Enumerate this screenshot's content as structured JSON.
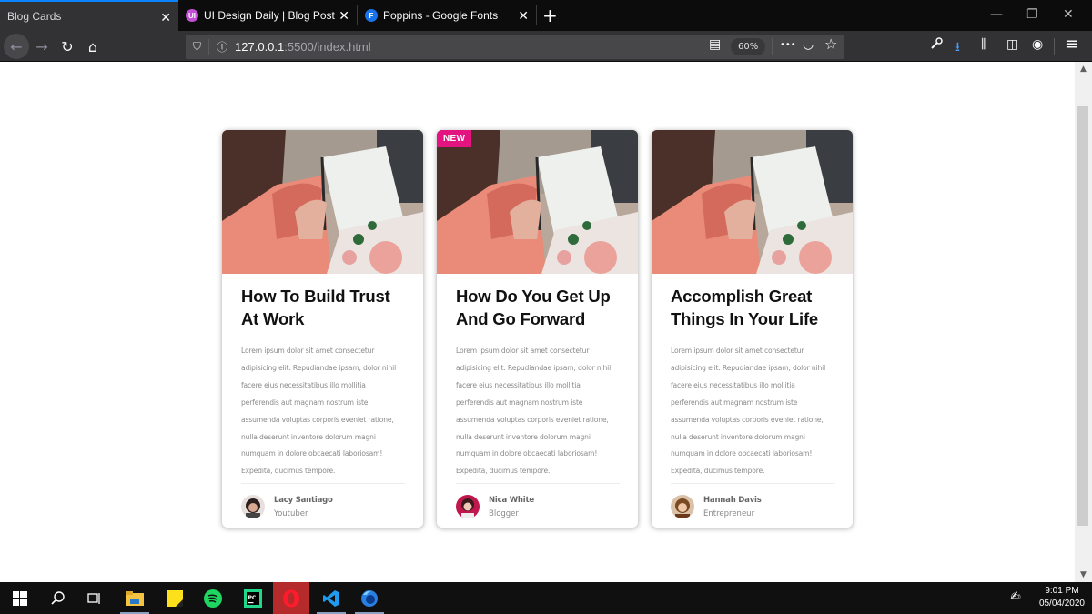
{
  "browser": {
    "tabs": [
      {
        "title": "Blog Cards",
        "active": true,
        "favicon": "none"
      },
      {
        "title": "UI Design Daily | Blog Post",
        "active": false,
        "favicon": "ui-logo",
        "favicon_color": "#c34fd4",
        "favicon_text": "UI"
      },
      {
        "title": "Poppins - Google Fonts",
        "active": false,
        "favicon": "fonts-logo",
        "favicon_color": "#1a73e8",
        "favicon_text": "F"
      }
    ],
    "close_glyph": "✕",
    "new_tab_glyph": "+",
    "window_controls": {
      "minimize": "—",
      "restore": "❐",
      "close": "✕"
    },
    "url": {
      "host": "127.0.0.1",
      "rest": ":5500/index.html"
    },
    "zoom_level": "60%",
    "nav_glyphs": {
      "back": "←",
      "forward": "→",
      "reload": "↻",
      "home": "⌂"
    },
    "toolbar_glyphs": {
      "reader": "▤",
      "more": "•••",
      "pocket": "◡",
      "star": "☆",
      "wrench": "🔧",
      "download": "⭳",
      "library": "⫼",
      "sidebar": "◫",
      "account": "◉",
      "menu": "≡"
    },
    "accent_color": "#0a84ff"
  },
  "page": {
    "cards": [
      {
        "badge": null,
        "title": "How To Build Trust At Work",
        "text": "Lorem ipsum dolor sit amet consectetur adipisicing elit. Repudiandae ipsam, dolor nihil facere eius necessitatibus illo mollitia perferendis aut magnam nostrum iste assumenda voluptas corporis eveniet ratione, nulla deserunt inventore dolorum magni numquam in dolore obcaecati laboriosam! Expedita, ducimus tempore.",
        "author": {
          "name": "Lacy Santiago",
          "role": "Youtuber",
          "avatar_color": "#3a2a2a"
        }
      },
      {
        "badge": "NEW",
        "title": "How Do You Get Up And Go Forward",
        "text": "Lorem ipsum dolor sit amet consectetur adipisicing elit. Repudiandae ipsam, dolor nihil facere eius necessitatibus illo mollitia perferendis aut magnam nostrum iste assumenda voluptas corporis eveniet ratione, nulla deserunt inventore dolorum magni numquam in dolore obcaecati laboriosam! Expedita, ducimus tempore.",
        "author": {
          "name": "Nica White",
          "role": "Blogger",
          "avatar_color": "#c0174f"
        }
      },
      {
        "badge": null,
        "title": "Accomplish Great Things In Your Life",
        "text": "Lorem ipsum dolor sit amet consectetur adipisicing elit. Repudiandae ipsam, dolor nihil facere eius necessitatibus illo mollitia perferendis aut magnam nostrum iste assumenda voluptas corporis eveniet ratione, nulla deserunt inventore dolorum magni numquam in dolore obcaecati laboriosam! Expedita, ducimus tempore.",
        "author": {
          "name": "Hannah Davis",
          "role": "Entrepreneur",
          "avatar_color": "#a0703a"
        }
      }
    ],
    "badge_color": "#e3137f"
  },
  "scrollbar": {
    "up": "▲",
    "down": "▼"
  },
  "taskbar": {
    "apps": [
      "start",
      "search",
      "task-view",
      "file-explorer",
      "sticky-notes",
      "spotify",
      "pycharm",
      "opera",
      "vscode",
      "firefox-dev"
    ],
    "time": "9:01 PM",
    "date": "05/04/2020"
  }
}
